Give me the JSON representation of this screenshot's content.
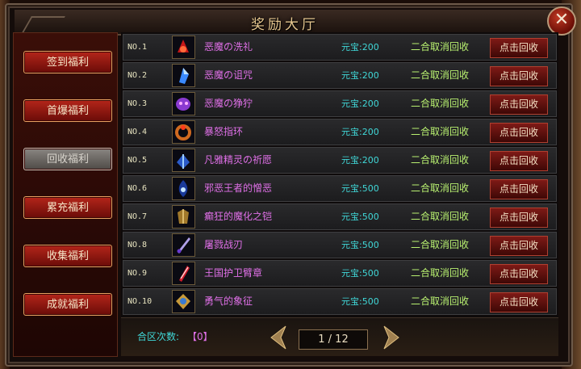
{
  "window": {
    "title": "奖励大厅",
    "close_symbol": "✕"
  },
  "sidebar": {
    "items": [
      {
        "label": "签到福利",
        "state": "normal"
      },
      {
        "label": "首爆福利",
        "state": "normal"
      },
      {
        "label": "回收福利",
        "state": "selected"
      },
      {
        "label": "累充福利",
        "state": "normal"
      },
      {
        "label": "收集福利",
        "state": "normal"
      },
      {
        "label": "成就福利",
        "state": "normal"
      }
    ]
  },
  "table": {
    "rows": [
      {
        "no": "NO.1",
        "name": "恶魔の洗礼",
        "price": "元宝:200",
        "merge": "二合取消回收",
        "button": "点击回收",
        "icon": "red-helmet-icon"
      },
      {
        "no": "NO.2",
        "name": "恶魔の诅咒",
        "price": "元宝:200",
        "merge": "二合取消回收",
        "button": "点击回收",
        "icon": "blue-crystal-icon"
      },
      {
        "no": "NO.3",
        "name": "恶魔の狰狞",
        "price": "元宝:200",
        "merge": "二合取消回收",
        "button": "点击回收",
        "icon": "purple-mask-icon"
      },
      {
        "no": "NO.4",
        "name": "暴怒指环",
        "price": "元宝:200",
        "merge": "二合取消回收",
        "button": "点击回收",
        "icon": "fire-ring-icon"
      },
      {
        "no": "NO.5",
        "name": "凡雅精灵の祈愿",
        "price": "元宝:200",
        "merge": "二合取消回收",
        "button": "点击回收",
        "icon": "blue-wings-icon"
      },
      {
        "no": "NO.6",
        "name": "邪恶王者的憎恶",
        "price": "元宝:500",
        "merge": "二合取消回收",
        "button": "点击回收",
        "icon": "blue-flame-icon"
      },
      {
        "no": "NO.7",
        "name": "癫狂的魔化之铠",
        "price": "元宝:500",
        "merge": "二合取消回收",
        "button": "点击回收",
        "icon": "gold-armor-icon"
      },
      {
        "no": "NO.8",
        "name": "屠戮战刃",
        "price": "元宝:500",
        "merge": "二合取消回收",
        "button": "点击回收",
        "icon": "violet-blade-icon"
      },
      {
        "no": "NO.9",
        "name": "王国护卫臂章",
        "price": "元宝:500",
        "merge": "二合取消回收",
        "button": "点击回收",
        "icon": "red-armband-icon"
      },
      {
        "no": "NO.10",
        "name": "勇气的象征",
        "price": "元宝:500",
        "merge": "二合取消回收",
        "button": "点击回收",
        "icon": "gold-emblem-icon"
      }
    ]
  },
  "footer": {
    "merge_count_label": "合区次数:",
    "merge_count_value": "【0】",
    "page": "1 / 12"
  },
  "colors": {
    "name": "#e070e8",
    "price": "#40d8d8",
    "merge": "#b8f070",
    "title": "#e8c890"
  }
}
